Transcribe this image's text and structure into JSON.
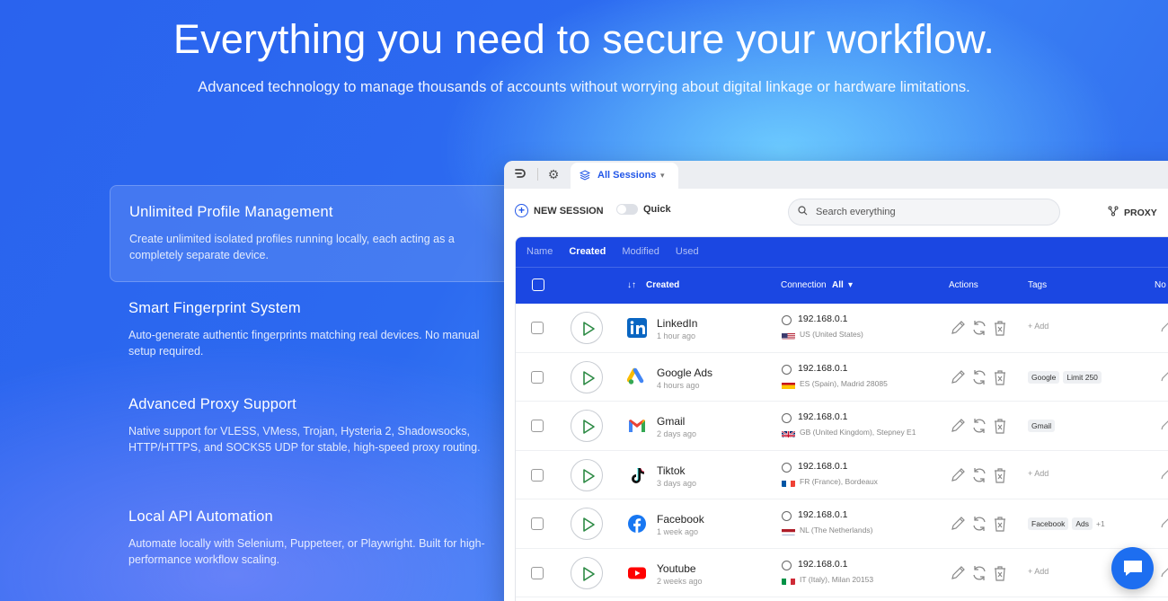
{
  "hero": {
    "title": "Everything you need to secure your workflow.",
    "subtitle": "Advanced technology to manage thousands of accounts without worrying about digital linkage or hardware limitations."
  },
  "features": [
    {
      "title": "Unlimited Profile Management",
      "desc": "Create unlimited isolated profiles running locally, each acting as a completely separate device.",
      "active": true
    },
    {
      "title": "Smart Fingerprint System",
      "desc": "Auto-generate authentic fingerprints matching real devices. No manual setup required."
    },
    {
      "title": "Advanced Proxy Support",
      "desc": "Native support for VLESS, VMess, Trojan, Hysteria 2, Shadowsocks, HTTP/HTTPS, and SOCKS5 UDP for stable, high-speed proxy routing."
    },
    {
      "title": "Local API Automation",
      "desc": "Automate locally with Selenium, Puppeteer, or Playwright. Built for high-performance workflow scaling."
    }
  ],
  "app": {
    "tab_label": "All Sessions",
    "new_session": "NEW SESSION",
    "quick": "Quick",
    "search_placeholder": "Search everything",
    "proxy": "PROXY",
    "subtabs": [
      "Name",
      "Created",
      "Modified",
      "Used"
    ],
    "active_subtab": "Created",
    "columns": {
      "created": "Created",
      "connection": "Connection",
      "connection_filter": "All",
      "actions": "Actions",
      "tags": "Tags",
      "notes": "No"
    },
    "add_tag": "+ Add",
    "rows": [
      {
        "name": "LinkedIn",
        "time": "1 hour ago",
        "ip": "192.168.0.1",
        "location": "US (United States)",
        "flag": "us",
        "tags": []
      },
      {
        "name": "Google Ads",
        "time": "4 hours ago",
        "ip": "192.168.0.1",
        "location": "ES (Spain), Madrid 28085",
        "flag": "es",
        "tags": [
          "Google",
          "Limit 250"
        ]
      },
      {
        "name": "Gmail",
        "time": "2 days ago",
        "ip": "192.168.0.1",
        "location": "GB (United Kingdom), Stepney E1",
        "flag": "gb",
        "tags": [
          "Gmail"
        ]
      },
      {
        "name": "Tiktok",
        "time": "3 days ago",
        "ip": "192.168.0.1",
        "location": "FR (France), Bordeaux",
        "flag": "fr",
        "tags": []
      },
      {
        "name": "Facebook",
        "time": "1 week ago",
        "ip": "192.168.0.1",
        "location": "NL (The Netherlands)",
        "flag": "nl",
        "tags": [
          "Facebook",
          "Ads"
        ],
        "extra": "+1"
      },
      {
        "name": "Youtube",
        "time": "2 weeks ago",
        "ip": "192.168.0.1",
        "location": "IT (Italy), Milan 20153",
        "flag": "it",
        "tags": []
      }
    ]
  },
  "colors": {
    "accent": "#1b47e2",
    "play": "#2c8a44"
  }
}
